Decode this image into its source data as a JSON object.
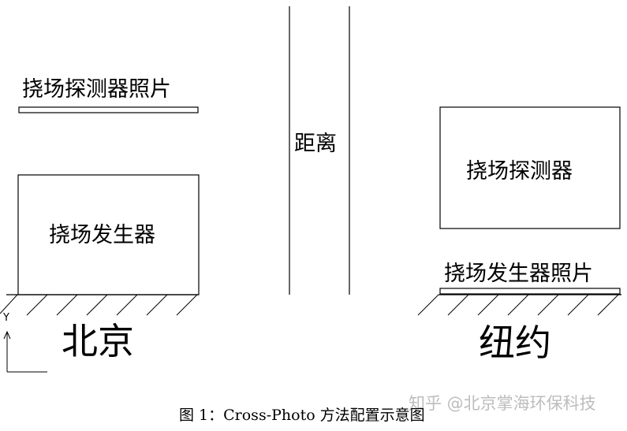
{
  "diagram": {
    "left_site": {
      "photo_label": "挠场探测器照片",
      "generator_label": "挠场发生器",
      "city": "北京"
    },
    "center": {
      "distance_label": "距离"
    },
    "right_site": {
      "detector_label": "挠场探测器",
      "photo_label": "挠场发生器照片",
      "city": "纽约"
    },
    "axis_label": "Y"
  },
  "watermark": "知乎 @北京掌海环保科技",
  "caption": "图 1：Cross-Photo 方法配置示意图"
}
